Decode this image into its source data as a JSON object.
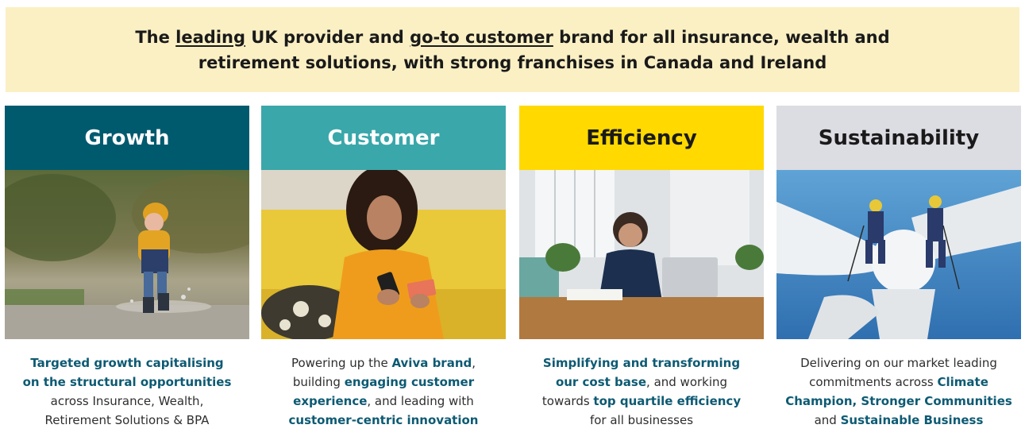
{
  "banner": {
    "line1_pre": "The ",
    "line1_u1": "leading",
    "line1_mid": " UK provider and ",
    "line1_u2": "go-to customer",
    "line1_post": " brand for all insurance, wealth and",
    "line2": "retirement solutions, with strong franchises in Canada and Ireland"
  },
  "cards": {
    "growth": {
      "title": "Growth",
      "photo": "child-jumping-in-puddle-photo",
      "l1": "Targeted growth capitalising",
      "l2": "on the structural opportunities",
      "l3": "across Insurance, Wealth,",
      "l4": "Retirement Solutions & BPA"
    },
    "customer": {
      "title": "Customer",
      "photo": "woman-with-phone-and-card-photo",
      "l1a": "Powering up the ",
      "l1b": "Aviva brand",
      "l1c": ",",
      "l2a": "building ",
      "l2b": "engaging customer",
      "l3a": "experience",
      "l3b": ", and leading with",
      "l4": "customer-centric innovation"
    },
    "efficiency": {
      "title": "Efficiency",
      "photo": "woman-working-on-laptop-photo",
      "l1": "Simplifying and transforming",
      "l2a": "our cost base",
      "l2b": ", and working",
      "l3a": "towards ",
      "l3b": "top quartile efficiency",
      "l4": "for all businesses"
    },
    "sustainability": {
      "title": "Sustainability",
      "photo": "wind-turbine-technicians-photo",
      "l1": "Delivering on our market leading",
      "l2a": "commitments across ",
      "l2b": "Climate",
      "l3a": "Champion, Stronger Communities",
      "l4a": "and ",
      "l4b": "Sustainable Business"
    }
  },
  "colors": {
    "growth": "#005a6e",
    "customer": "#3aa7aa",
    "efficiency": "#ffd900",
    "sustainability": "#dcdce3",
    "banner": "#fbf0c4"
  }
}
